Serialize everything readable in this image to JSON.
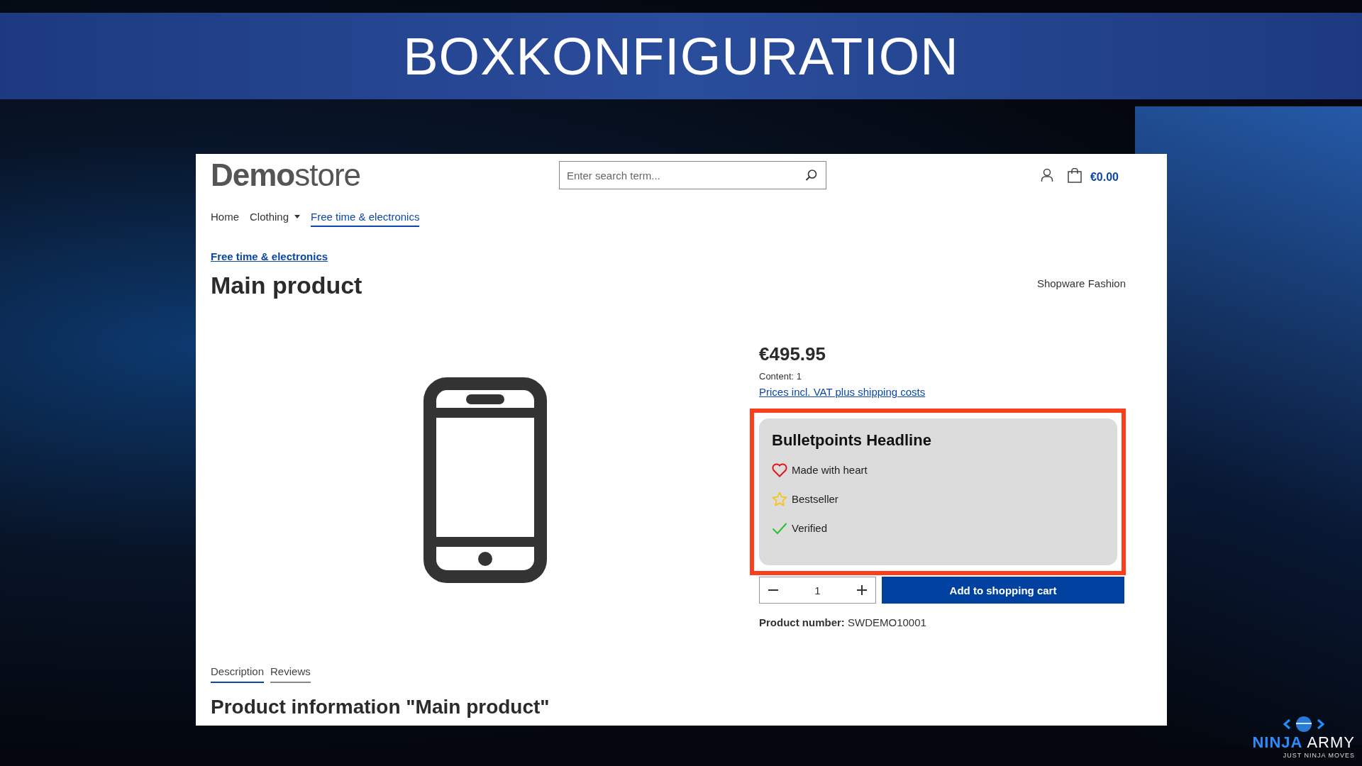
{
  "banner": {
    "title": "BOXKONFIGURATION"
  },
  "header": {
    "logo": "**Demo**store",
    "search": {
      "placeholder": "Enter search term..."
    },
    "cart_total": "€0.00"
  },
  "nav": [
    {
      "label": "Home",
      "selected": false,
      "dropdown": false
    },
    {
      "label": "Clothing",
      "selected": false,
      "dropdown": true
    },
    {
      "label": "Free time & electronics",
      "selected": true,
      "dropdown": false
    }
  ],
  "breadcrumb": "Free time & electronics",
  "product": {
    "title": "Main product",
    "manufacturer": "Shopware Fashion",
    "price": "€495.95",
    "content": "Content: 1",
    "tax_link": "Prices incl. VAT plus shipping costs",
    "bulletpoints": {
      "headline": "Bulletpoints Headline",
      "items": [
        {
          "kind": "heart",
          "label": "Made with heart"
        },
        {
          "kind": "star",
          "label": "Bestseller"
        },
        {
          "kind": "check",
          "label": "Verified"
        }
      ]
    },
    "quantity": "1",
    "add_button": "Add to shopping cart",
    "product_number": "**Product number:** SWDEMO10001"
  },
  "tabs": [
    {
      "label": "Description",
      "selected": true
    },
    {
      "label": "Reviews",
      "selected": false
    }
  ],
  "section_heading": "Product information \"Main product\"",
  "brand": {
    "name_first": "NINJA",
    "name_second": "ARMY",
    "tagline": "JUST NINJA MOVES"
  }
}
